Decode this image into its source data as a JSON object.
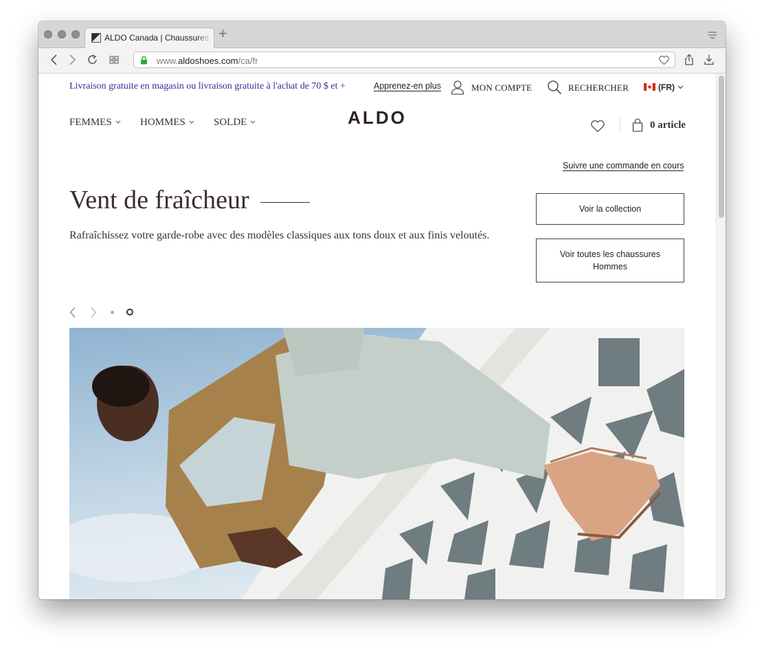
{
  "browser": {
    "tab_title": "ALDO Canada | Chaussures, bottes, sacs à main",
    "new_tab_symbol": "+",
    "url_prefix": "www.",
    "url_domain": "aldoshoes.com",
    "url_path": "/ca/fr"
  },
  "topbar": {
    "promo": "Livraison gratuite en magasin ou livraison gratuite à l'achat de 70 $ et +",
    "learn_more": "Apprenez-en plus",
    "account": "MON COMPTE",
    "search": "RECHERCHER",
    "language": "(FR)"
  },
  "nav": {
    "items": [
      {
        "label": "FEMMES"
      },
      {
        "label": "HOMMES"
      },
      {
        "label": "SOLDE"
      }
    ],
    "logo": "ALDO",
    "cart": "0 article"
  },
  "hero": {
    "track_order": "Suivre une commande en cours",
    "title": "Vent de fraîcheur",
    "description": "Rafraîchissez votre garde-robe avec des modèles classiques aux tons doux et aux finis veloutés.",
    "cta_primary": "Voir la collection",
    "cta_secondary": "Voir toutes les chaussures Hommes",
    "carousel": {
      "slide_count": 2,
      "active_slide": 2
    }
  },
  "colors": {
    "promo_text": "#3a2a9a",
    "title_text": "#3a2e2c",
    "lock_green": "#28a745",
    "flag_red": "#d52b1e"
  },
  "icons": [
    "back-icon",
    "forward-icon",
    "reload-icon",
    "grid-icon",
    "lock-icon",
    "heart-icon",
    "share-icon",
    "download-icon",
    "user-icon",
    "search-icon",
    "flag-canada-icon",
    "chevron-down-icon",
    "bag-icon",
    "arrow-left-icon",
    "arrow-right-icon"
  ]
}
